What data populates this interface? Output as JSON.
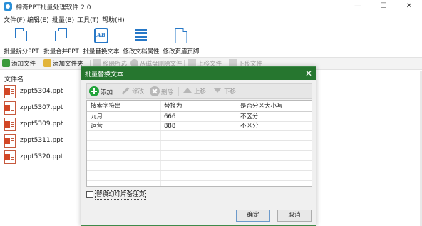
{
  "app": {
    "title": "神奇PPT批量处理软件 2.0"
  },
  "window_controls": {
    "minimize": "—",
    "maximize": "☐",
    "close": "✕"
  },
  "menu": [
    "文件(F)",
    "编辑(E)",
    "批量(B)",
    "工具(T)",
    "帮助(H)"
  ],
  "toolbar": [
    {
      "label": "批量拆分PPT",
      "icon": "split-docs-icon"
    },
    {
      "label": "批量合并PPT",
      "icon": "merge-docs-icon"
    },
    {
      "label": "批量替换文本",
      "icon": "replace-text-icon"
    },
    {
      "label": "修改文档属性",
      "icon": "properties-list-icon"
    },
    {
      "label": "修改页眉页脚",
      "icon": "header-footer-page-icon"
    }
  ],
  "toolbar2": {
    "add_file": "添加文件",
    "add_folder": "添加文件夹",
    "remove_selected": "移除所选",
    "delete_from_disk": "从磁盘删除文件",
    "move_up": "上移文件",
    "move_down": "下移文件"
  },
  "file_list": {
    "header": "文件名",
    "files": [
      "zppt5304.ppt",
      "zppt5307.ppt",
      "zppt5309.ppt",
      "zppt5311.ppt",
      "zppt5320.ppt"
    ]
  },
  "dialog": {
    "title": "批量替换文本",
    "close": "✕",
    "toolbar": {
      "add": "添加",
      "edit": "修改",
      "delete": "删除",
      "up": "上移",
      "down": "下移"
    },
    "columns": [
      "搜索字符串",
      "替换为",
      "是否分区大小写"
    ],
    "rows": [
      [
        "九月",
        "666",
        "不区分"
      ],
      [
        "运营",
        "888",
        "不区分"
      ]
    ],
    "checkbox_label": "替换幻灯片备注页",
    "ok": "确定",
    "cancel": "取消"
  },
  "colors": {
    "dialog_title_bg": "#26762f",
    "accent_blue": "#2778c7",
    "ppt_red": "#d24726"
  }
}
